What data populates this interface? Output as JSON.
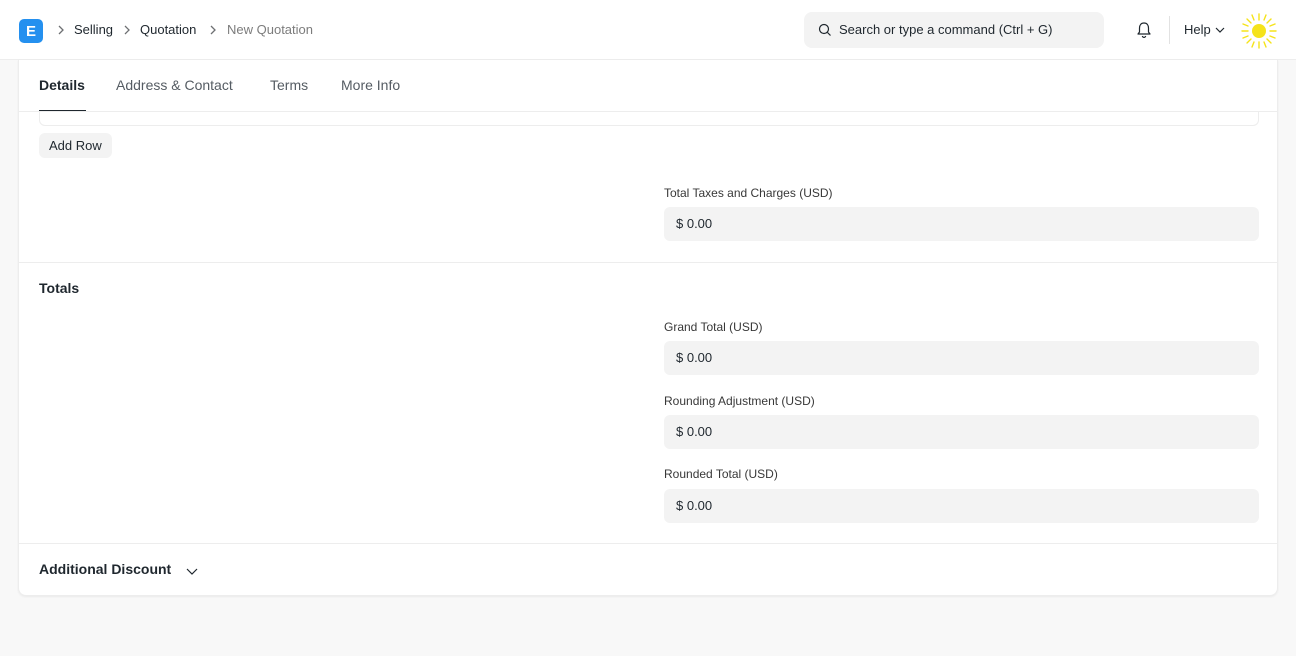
{
  "app": {
    "logo_letter": "E"
  },
  "breadcrumbs": [
    "Selling",
    "Quotation",
    "New Quotation"
  ],
  "search": {
    "placeholder": "Search or type a command (Ctrl + G)"
  },
  "navbar": {
    "help_label": "Help"
  },
  "tabs": [
    "Details",
    "Address & Contact",
    "Terms",
    "More Info"
  ],
  "taxes": {
    "add_row_label": "Add Row",
    "total_taxes_label": "Total Taxes and Charges (USD)",
    "total_taxes_value": "$ 0.00"
  },
  "totals": {
    "title": "Totals",
    "grand_total_label": "Grand Total (USD)",
    "grand_total_value": "$ 0.00",
    "rounding_adjustment_label": "Rounding Adjustment (USD)",
    "rounding_adjustment_value": "$ 0.00",
    "rounded_total_label": "Rounded Total (USD)",
    "rounded_total_value": "$ 0.00"
  },
  "additional_discount": {
    "title": "Additional Discount"
  },
  "colors": {
    "brand": "#2490ef",
    "avatar": "#f5e31a",
    "field_bg": "#f3f3f3"
  },
  "icons": [
    "search-icon",
    "bell-icon",
    "chevron-down-icon",
    "chevron-right-icon"
  ]
}
